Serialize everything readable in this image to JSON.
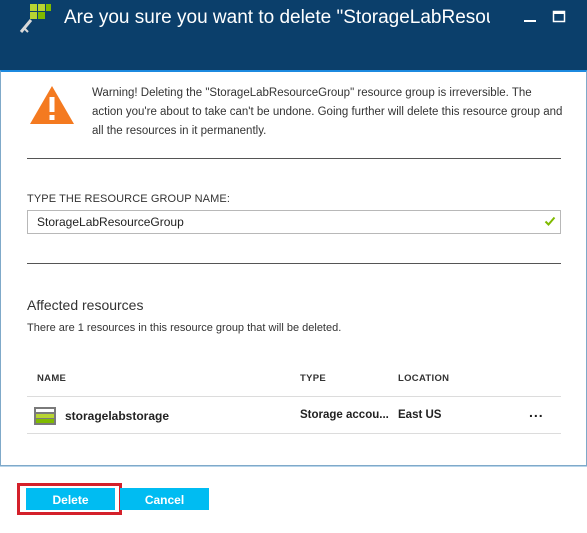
{
  "dialog": {
    "title": "Are you sure you want to delete \"StorageLabResourc...",
    "warning": "Warning! Deleting the \"StorageLabResourceGroup\" resource group is irreversible. The action you're about to take can't be undone. Going further will delete this resource group and all the resources in it permanently."
  },
  "confirm_field": {
    "label": "TYPE THE RESOURCE GROUP NAME:",
    "value": "StorageLabResourceGroup"
  },
  "affected": {
    "title": "Affected resources",
    "description": "There are 1 resources in this resource group that will be deleted.",
    "columns": [
      "NAME",
      "TYPE",
      "LOCATION"
    ],
    "rows": [
      {
        "name": "storagelabstorage",
        "type": "Storage accou...",
        "location": "East US",
        "more": "..."
      }
    ]
  },
  "footer": {
    "delete_label": "Delete",
    "cancel_label": "Cancel"
  },
  "colors": {
    "titlebar": "#0b3f6b",
    "button": "#00bcf2",
    "warning": "#f47a20",
    "highlight": "#d4202a",
    "check": "#7fba00"
  },
  "icons": [
    "key-logo-icon",
    "minimize-icon",
    "maximize-icon",
    "warning-icon",
    "checkmark-icon",
    "storage-account-icon",
    "more-icon"
  ]
}
